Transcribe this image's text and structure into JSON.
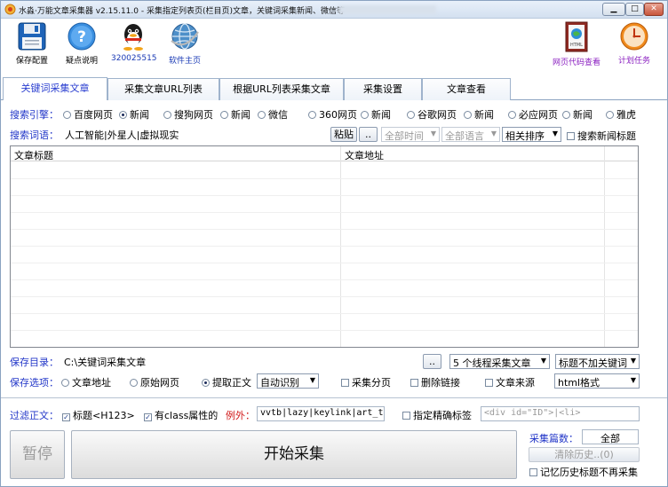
{
  "window": {
    "title": "水淼·万能文章采集器 v2.15.11.0 - 采集指定列表页(栏目页)文章，关键词采集新闻、微信等",
    "min_label": "▁",
    "max_label": "□",
    "close_label": "✕"
  },
  "toolbar": {
    "save": "保存配置",
    "help": "疑点说明",
    "qq": "320025515",
    "home": "软件主页",
    "view_code": "网页代码查看",
    "schedule": "计划任务"
  },
  "tabs": [
    "关键词采集文章",
    "采集文章URL列表",
    "根据URL列表采集文章",
    "采集设置",
    "文章查看"
  ],
  "search": {
    "engine_label": "搜索引擎：",
    "engines": [
      "百度网页",
      "新闻",
      "搜狗网页",
      "新闻",
      "微信",
      "360网页",
      "新闻",
      "谷歌网页",
      "新闻",
      "必应网页",
      "新闻",
      "雅虎"
    ],
    "selected_engine_index": 1,
    "keyword_label": "搜索词语：",
    "keyword_value": "人工智能|外星人|虚拟现实",
    "paste_button": "粘贴",
    "more_button": "..",
    "time_select": "全部时间",
    "lang_select": "全部语言",
    "sort_select": "相关排序",
    "news_title_check": "搜索新闻标题"
  },
  "table": {
    "columns": [
      "文章标题",
      "文章地址"
    ],
    "rows": []
  },
  "output": {
    "dir_label": "保存目录：",
    "dir_value": "C:\\关键词采集文章",
    "browse_button": "..",
    "thread_select": "5 个线程采集文章",
    "keyword_select": "标题不加关键词",
    "save_opt_label": "保存选项：",
    "opt_article_url": "文章地址",
    "opt_raw_page": "原始网页",
    "opt_extract_body": "提取正文",
    "extract_mode_select": "自动识别",
    "chk_paging": "采集分页",
    "chk_remove_links": "删除链接",
    "chk_source": "文章来源",
    "format_select": "html格式"
  },
  "filter": {
    "label": "过滤正文：",
    "chk_title": "标题<H123>",
    "chk_class": "有class属性的",
    "except_label": "例外：",
    "except_value": "vvtb|lazy|keylink|art_t",
    "chk_exact_tag": "指定精确标签",
    "tag_placeholder": "<div id=\"ID\">|<li>"
  },
  "actions": {
    "stop": "暂停",
    "start": "开始采集",
    "count_label": "采集篇数：",
    "count_value": "全部",
    "clear_history": "清除历史..(0)",
    "remember_history": "记忆历史标题不再采集"
  },
  "colors": {
    "label_blue": "#2236c8",
    "exception_red": "#d01818",
    "tab_active_text": "#2a3ed0"
  }
}
